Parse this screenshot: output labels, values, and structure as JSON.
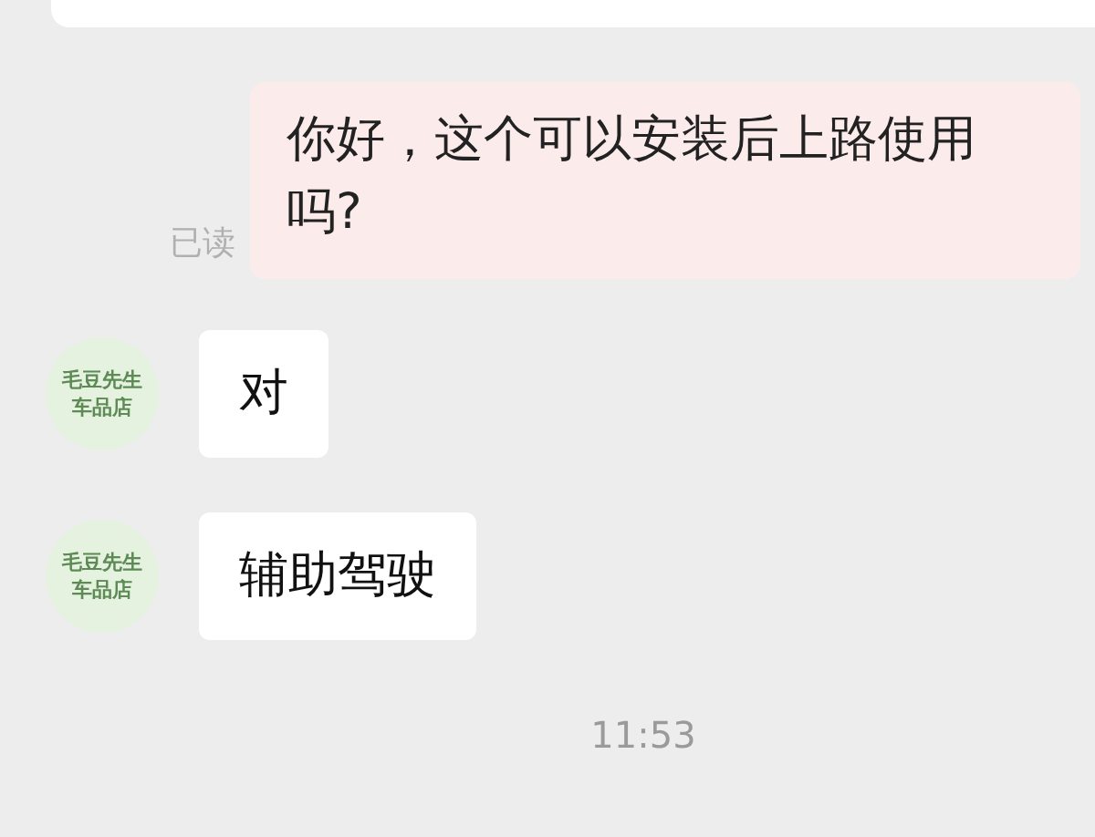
{
  "messages": [
    {
      "kind": "outgoing",
      "text": "你好，这个可以安装后上路使用吗?",
      "receipt": "已读"
    },
    {
      "kind": "incoming",
      "avatar": [
        "毛豆先生",
        "车品店"
      ],
      "text": "对"
    },
    {
      "kind": "incoming",
      "avatar": [
        "毛豆先生",
        "车品店"
      ],
      "text": "辅助驾驶"
    }
  ],
  "timestamp": "11:53"
}
